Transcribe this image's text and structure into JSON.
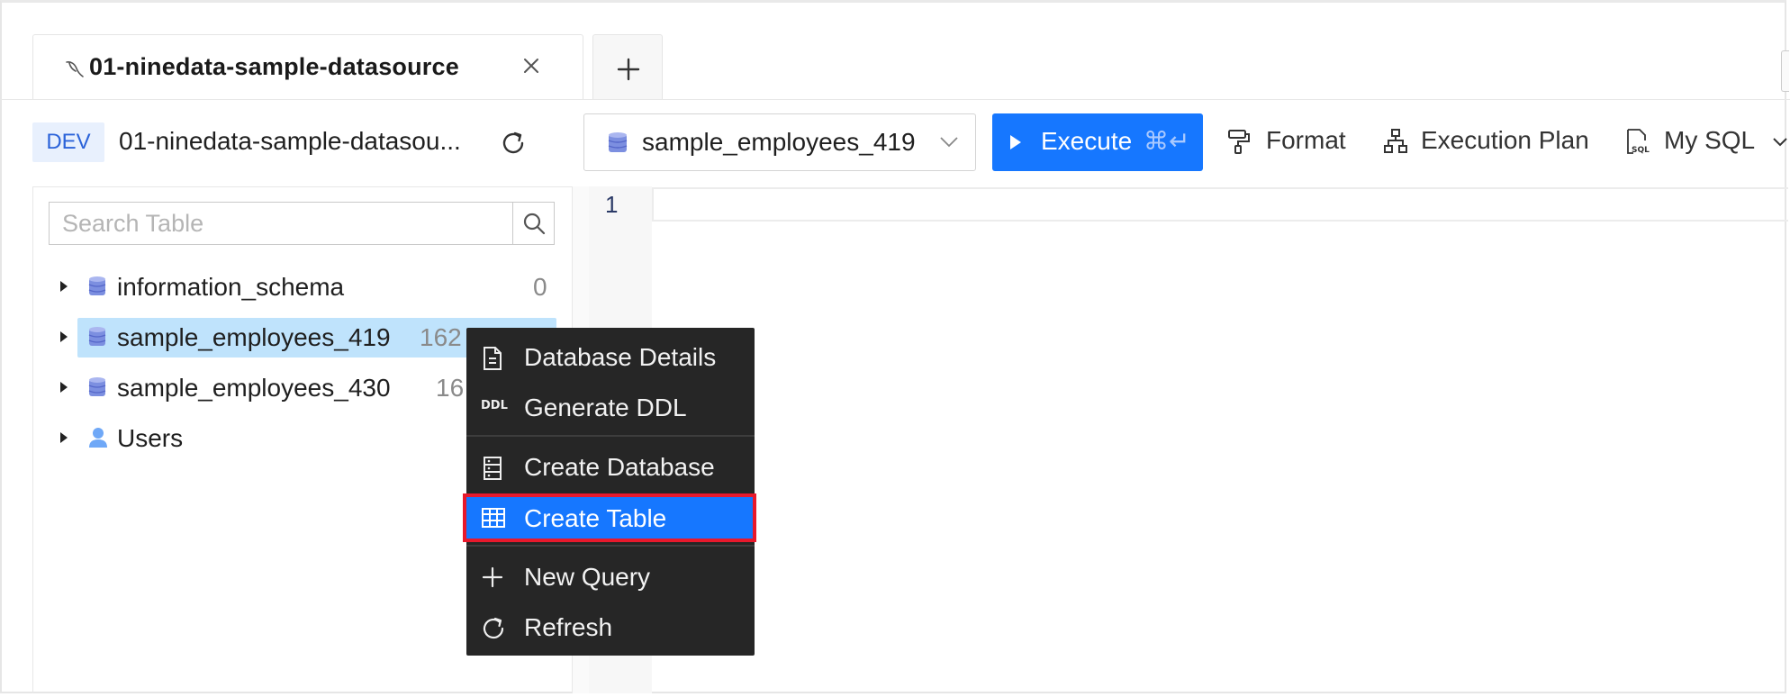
{
  "tab": {
    "title": "01-ninedata-sample-datasource",
    "close_icon": "close-icon",
    "add_icon": "plus-icon"
  },
  "toolbar": {
    "env": "DEV",
    "datasource": "01-ninedata-sample-datasou...",
    "selected_db": "sample_employees_419",
    "execute_label": "Execute",
    "execute_shortcut": "⌘↵",
    "format_label": "Format",
    "plan_label": "Execution Plan",
    "mysql_label": "My SQL"
  },
  "search": {
    "placeholder": "Search Table"
  },
  "tree": [
    {
      "name": "information_schema",
      "count": "0",
      "icon": "database-icon"
    },
    {
      "name": "sample_employees_419",
      "count": "162",
      "icon": "database-icon",
      "selected": true
    },
    {
      "name": "sample_employees_430",
      "count": "16",
      "icon": "database-icon"
    },
    {
      "name": "Users",
      "count": "",
      "icon": "user-icon"
    }
  ],
  "editor": {
    "line_number": "1"
  },
  "context_menu": {
    "items": [
      {
        "label": "Database Details",
        "icon": "document-icon"
      },
      {
        "label": "Generate DDL",
        "icon": "ddl-icon"
      },
      {
        "label": "Create Database",
        "icon": "server-icon"
      },
      {
        "label": "Create Table",
        "icon": "table-icon",
        "active": true
      },
      {
        "label": "New Query",
        "icon": "plus-icon"
      },
      {
        "label": "Refresh",
        "icon": "refresh-icon"
      }
    ],
    "ddl_glyph": "DDL"
  },
  "colors": {
    "accent": "#1677ff",
    "menu_bg": "#262626",
    "selection": "#bfe3fc",
    "highlight_box": "#e8192c"
  }
}
